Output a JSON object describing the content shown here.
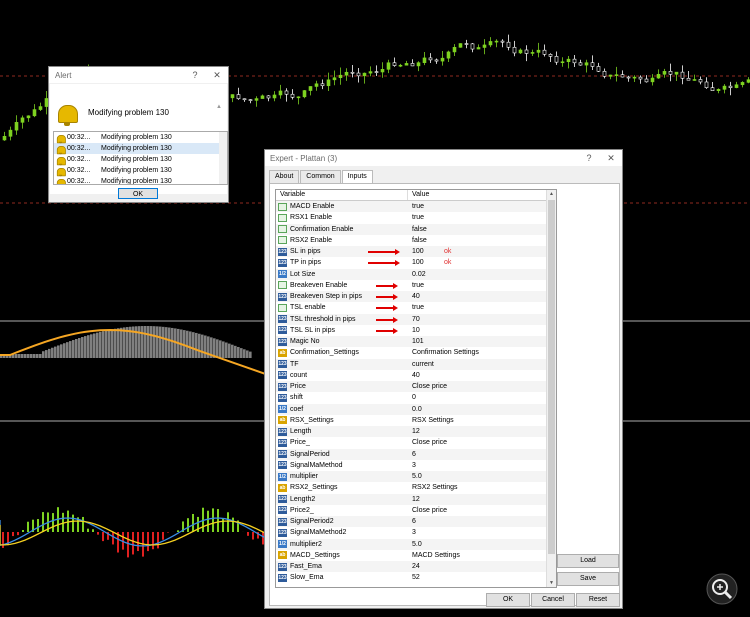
{
  "colors": {
    "dashed_line": "#c0392b",
    "bull_candle": "#7ed321",
    "bear_candle": "#ffffff",
    "histogram": "#808080",
    "ma_line": "#f5a623",
    "macd_up": "#7ed321",
    "macd_down": "#e02020",
    "macd_line": "#3a8ee6",
    "signal_line": "#f5d020",
    "arrow": "#e00000"
  },
  "alert": {
    "title": "Alert",
    "help_label": "?",
    "close_label": "✕",
    "message": "Modifying problem 130",
    "rows": [
      {
        "time": "00:32...",
        "message": "Modifying problem 130"
      },
      {
        "time": "00:32...",
        "message": "Modifying problem 130"
      },
      {
        "time": "00:32...",
        "message": "Modifying problem 130"
      },
      {
        "time": "00:32...",
        "message": "Modifying problem 130"
      },
      {
        "time": "00:32...",
        "message": "Modifying problem 130"
      }
    ],
    "ok_label": "OK",
    "icon": "bell-icon"
  },
  "expert": {
    "title": "Expert - Plattan (3)",
    "help_label": "?",
    "close_label": "✕",
    "tabs": [
      "About",
      "Common",
      "Inputs"
    ],
    "active_tab": "Inputs",
    "headers": {
      "variable": "Variable",
      "value": "Value"
    },
    "rows": [
      {
        "variable": "MACD Enable",
        "value": "true",
        "type": "bool"
      },
      {
        "variable": "RSX1 Enable",
        "value": "true",
        "type": "bool"
      },
      {
        "variable": "Confirmation Enable",
        "value": "false",
        "type": "bool"
      },
      {
        "variable": "RSX2 Enable",
        "value": "false",
        "type": "bool"
      },
      {
        "variable": "SL in pips",
        "value": "100",
        "type": "num",
        "arrow": true,
        "note": "ok"
      },
      {
        "variable": "TP in pips",
        "value": "100",
        "type": "num",
        "arrow": true,
        "note": "ok"
      },
      {
        "variable": "Lot Size",
        "value": "0.02",
        "type": "dbl"
      },
      {
        "variable": "Breakeven Enable",
        "value": "true",
        "type": "bool",
        "arrow": true
      },
      {
        "variable": "Breakeven Step in pips",
        "value": "40",
        "type": "num",
        "arrow": true
      },
      {
        "variable": "TSL enable",
        "value": "true",
        "type": "bool",
        "arrow": true
      },
      {
        "variable": "TSL threshold in pips",
        "value": "70",
        "type": "num",
        "arrow": true
      },
      {
        "variable": "TSL SL in pips",
        "value": "10",
        "type": "num",
        "arrow": true
      },
      {
        "variable": "Magic No",
        "value": "101",
        "type": "num"
      },
      {
        "variable": "Confirmation_Settings",
        "value": "Confirmation Settings",
        "type": "str"
      },
      {
        "variable": "TF",
        "value": "current",
        "type": "num"
      },
      {
        "variable": "count",
        "value": "40",
        "type": "num"
      },
      {
        "variable": "Price",
        "value": "Close price",
        "type": "num"
      },
      {
        "variable": "shift",
        "value": "0",
        "type": "num"
      },
      {
        "variable": "coef",
        "value": "0.0",
        "type": "dbl"
      },
      {
        "variable": "RSX_Settings",
        "value": "RSX Settings",
        "type": "str"
      },
      {
        "variable": "Length",
        "value": "12",
        "type": "num"
      },
      {
        "variable": "Price_",
        "value": "Close price",
        "type": "num"
      },
      {
        "variable": "SignalPeriod",
        "value": "6",
        "type": "num"
      },
      {
        "variable": "SignalMaMethod",
        "value": "3",
        "type": "num"
      },
      {
        "variable": "multiplier",
        "value": "5.0",
        "type": "dbl"
      },
      {
        "variable": "RSX2_Settings",
        "value": "RSX2 Settings",
        "type": "str"
      },
      {
        "variable": "Length2",
        "value": "12",
        "type": "num"
      },
      {
        "variable": "Price2_",
        "value": "Close price",
        "type": "num"
      },
      {
        "variable": "SignalPeriod2",
        "value": "6",
        "type": "num"
      },
      {
        "variable": "SignalMaMethod2",
        "value": "3",
        "type": "num"
      },
      {
        "variable": "multiplier2",
        "value": "5.0",
        "type": "dbl"
      },
      {
        "variable": "MACD_Settings",
        "value": "MACD Settings",
        "type": "str"
      },
      {
        "variable": "Fast_Ema",
        "value": "24",
        "type": "num"
      },
      {
        "variable": "Slow_Ema",
        "value": "52",
        "type": "num"
      }
    ],
    "load_label": "Load",
    "save_label": "Save",
    "ok_label": "OK",
    "cancel_label": "Cancel",
    "reset_label": "Reset"
  },
  "zoom_icon": "zoom-in-icon"
}
